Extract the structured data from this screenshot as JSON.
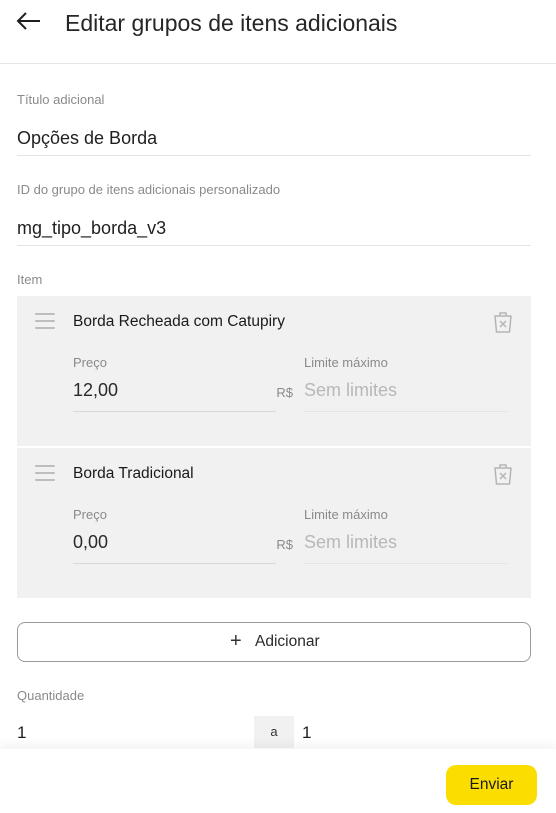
{
  "header": {
    "title": "Editar grupos de itens adicionais",
    "back_icon": "arrow-left-icon"
  },
  "form": {
    "title_label": "Título adicional",
    "title_value": "Opções de Borda",
    "id_label": "ID do grupo de itens adicionais personalizado",
    "id_value": "mg_tipo_borda_v3",
    "item_label": "Item",
    "items": [
      {
        "name": "Borda Recheada com Catupiry",
        "price_label": "Preço",
        "price_value": "12,00",
        "currency": "R$",
        "limit_label": "Limite máximo",
        "limit_placeholder": "Sem limites"
      },
      {
        "name": "Borda Tradicional",
        "price_label": "Preço",
        "price_value": "0,00",
        "currency": "R$",
        "limit_label": "Limite máximo",
        "limit_placeholder": "Sem limites"
      }
    ],
    "add_button_label": "Adicionar",
    "quantity_label": "Quantidade",
    "quantity_min": "1",
    "quantity_separator": "a",
    "quantity_max": "1"
  },
  "footer": {
    "submit_label": "Enviar"
  },
  "colors": {
    "accent": "#fbde00",
    "card_bg": "#f1f1f1"
  }
}
